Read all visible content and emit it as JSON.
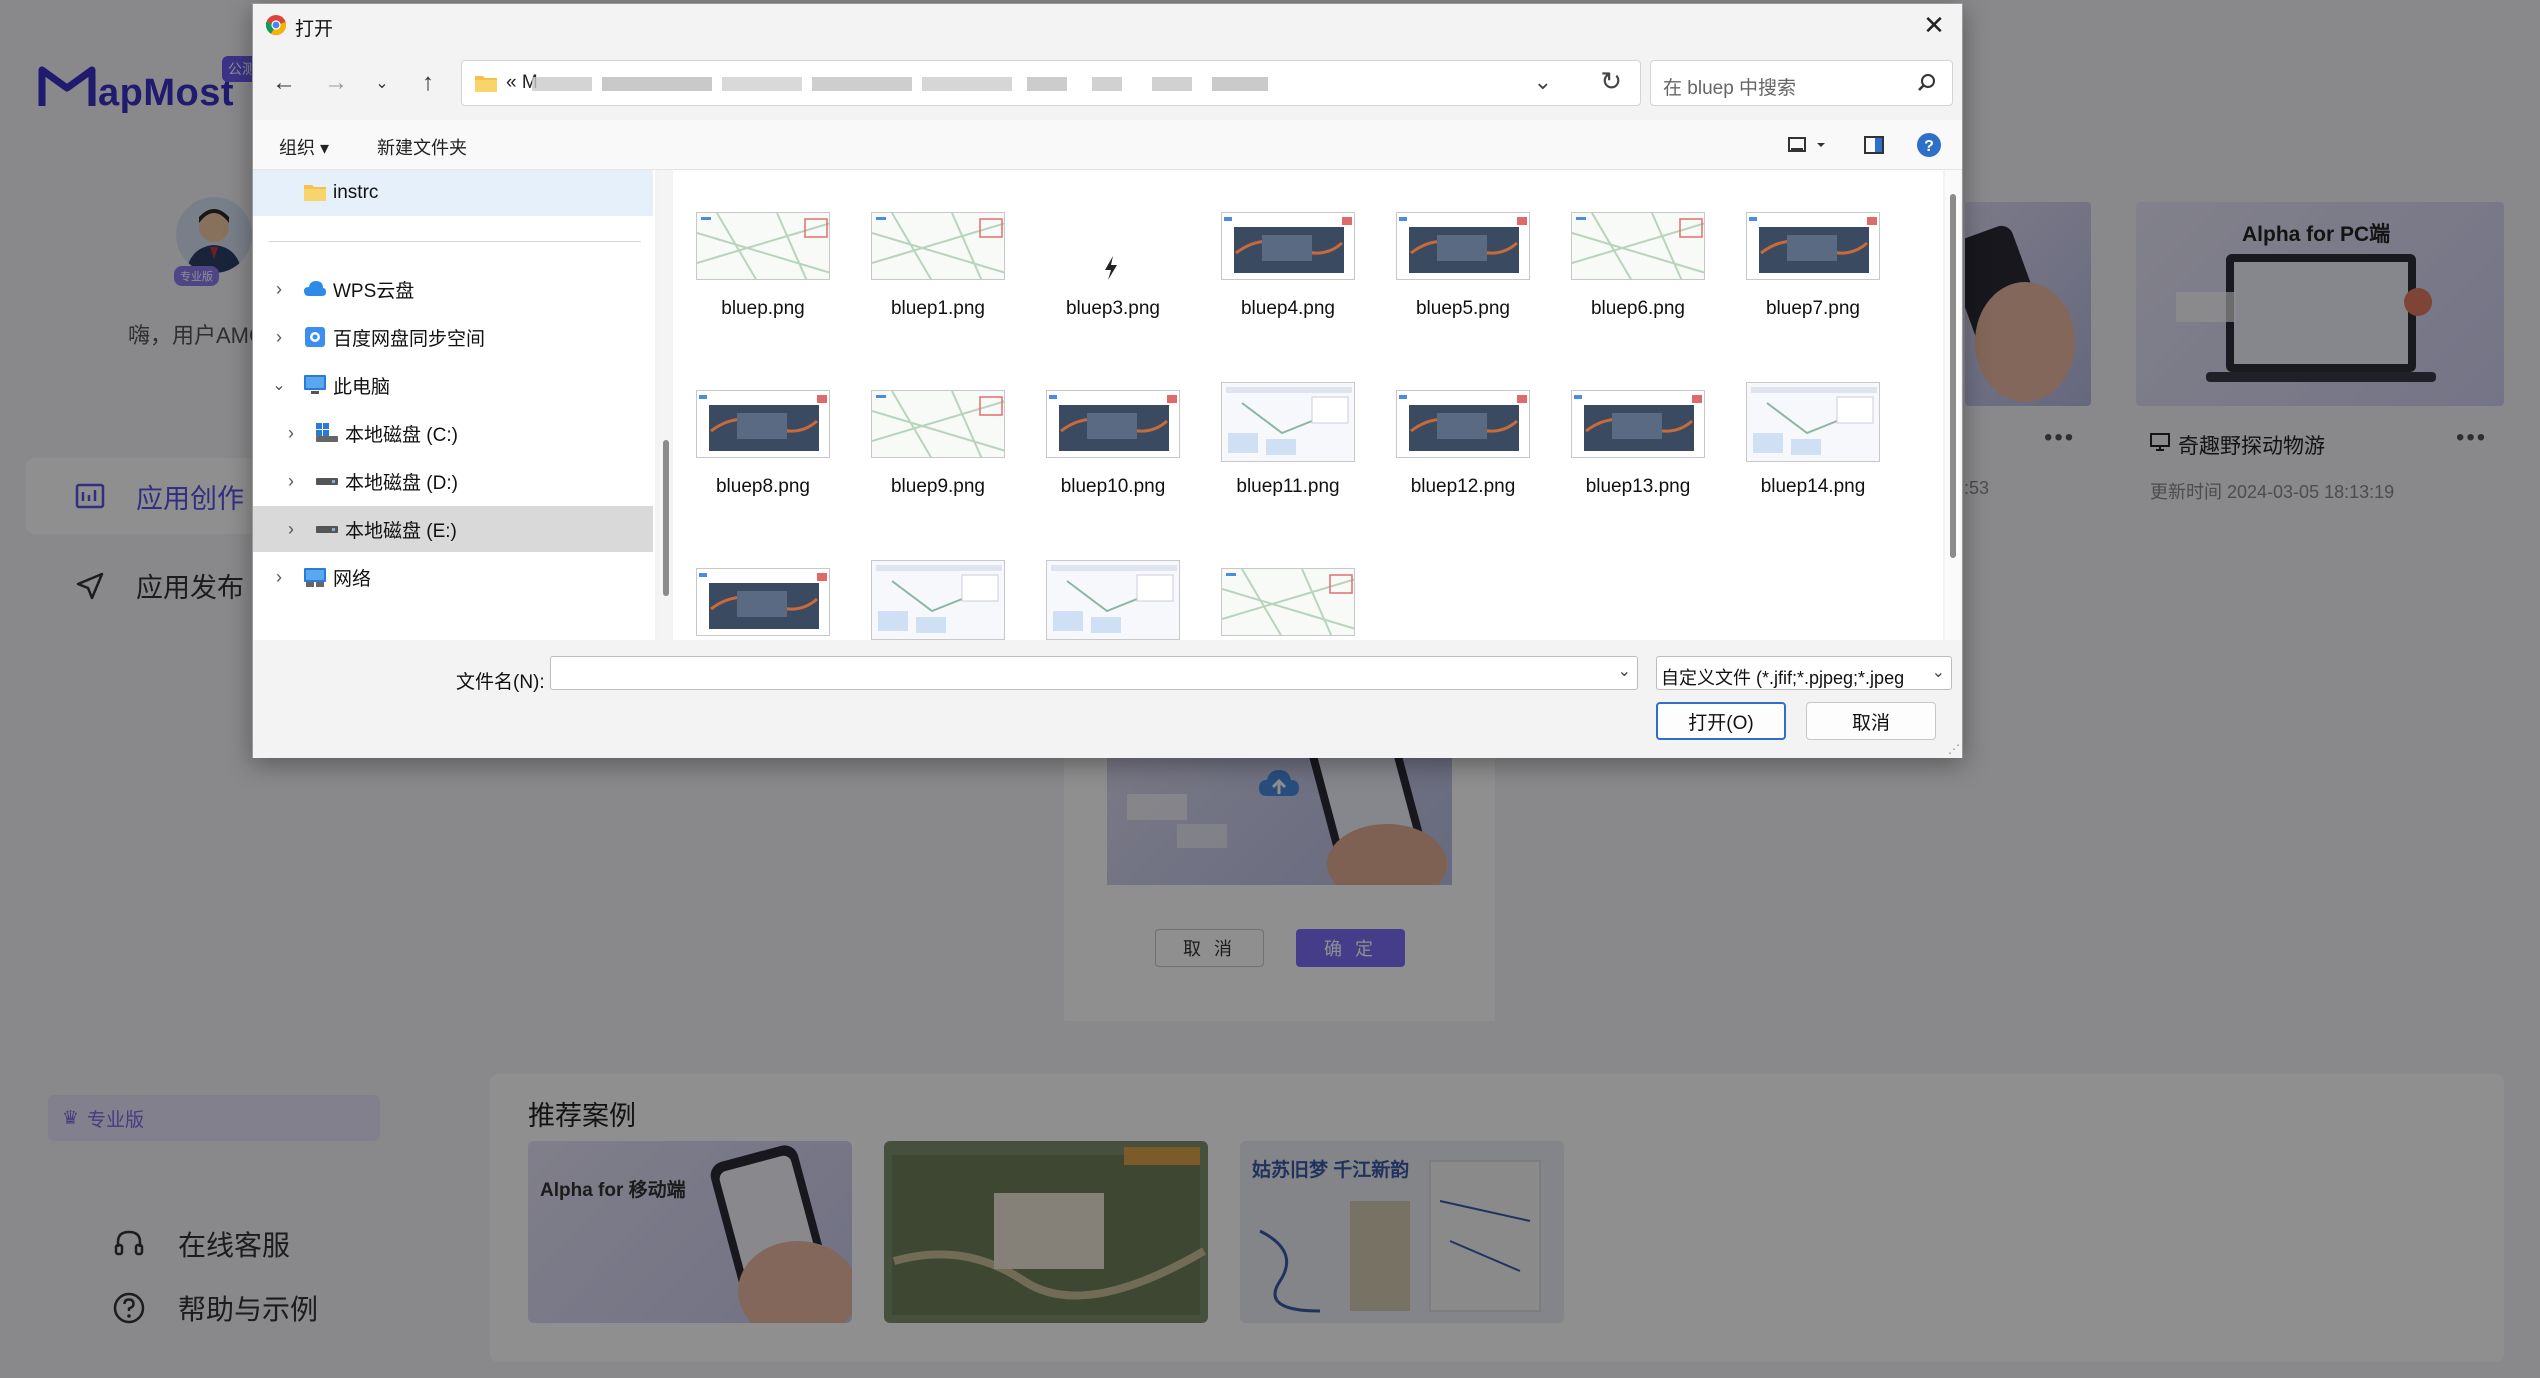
{
  "background_app": {
    "logo_text": "apMost",
    "logo_badge": "公测",
    "avatar_badge": "专业版",
    "greeting": "嗨，用户AMC",
    "nav": [
      {
        "label": "应用创作",
        "icon": "app-create-icon"
      },
      {
        "label": "应用发布",
        "icon": "send-icon"
      }
    ],
    "pro_label": "专业版",
    "side_links": [
      {
        "label": "在线客服",
        "icon": "headset-icon"
      },
      {
        "label": "帮助与示例",
        "icon": "help-circle-icon"
      }
    ],
    "recommend_title": "推荐案例",
    "recommend_cards": [
      {
        "title": "Alpha for 移动端"
      },
      {
        "title": ""
      },
      {
        "title": "姑苏旧梦 千江新韵"
      }
    ],
    "right_card": {
      "image_title": "Alpha for PC端",
      "name": "奇趣野探动物游",
      "update_time": "更新时间 2024-03-05 18:13:19",
      "partial_time": ":53"
    },
    "modal": {
      "cancel_label": "取 消",
      "ok_label": "确 定"
    },
    "colors": {
      "brand": "#5a52e8",
      "modal_ok": "#7b6cf6"
    }
  },
  "dialog": {
    "title": "打开",
    "address_prefix": "« M",
    "search_placeholder": "在 bluep 中搜索",
    "commands": {
      "organize": "组织 ▾",
      "new_folder": "新建文件夹"
    },
    "tree": [
      {
        "label": "instrc",
        "icon": "folder-icon",
        "selected": true
      },
      {
        "label": "WPS云盘",
        "icon": "cloud-icon"
      },
      {
        "label": "百度网盘同步空间",
        "icon": "baidu-drive-icon"
      },
      {
        "label": "此电脑",
        "icon": "computer-icon",
        "expanded": true
      },
      {
        "label": "本地磁盘 (C:)",
        "icon": "drive-c-icon"
      },
      {
        "label": "本地磁盘 (D:)",
        "icon": "drive-icon"
      },
      {
        "label": "本地磁盘 (E:)",
        "icon": "drive-icon",
        "highlighted": true
      },
      {
        "label": "网络",
        "icon": "network-icon"
      }
    ],
    "files": [
      {
        "name": "bluep.png",
        "kind": "map"
      },
      {
        "name": "bluep1.png",
        "kind": "map"
      },
      {
        "name": "bluep3.png",
        "kind": "icon"
      },
      {
        "name": "bluep4.png",
        "kind": "dark"
      },
      {
        "name": "bluep5.png",
        "kind": "dark"
      },
      {
        "name": "bluep6.png",
        "kind": "map"
      },
      {
        "name": "bluep7.png",
        "kind": "dark"
      },
      {
        "name": "bluep8.png",
        "kind": "dark"
      },
      {
        "name": "bluep9.png",
        "kind": "map"
      },
      {
        "name": "bluep10.png",
        "kind": "dark"
      },
      {
        "name": "bluep11.png",
        "kind": "ui"
      },
      {
        "name": "bluep12.png",
        "kind": "dark"
      },
      {
        "name": "bluep13.png",
        "kind": "dark"
      },
      {
        "name": "bluep14.png",
        "kind": "ui"
      },
      {
        "name": "",
        "kind": "dark"
      },
      {
        "name": "",
        "kind": "ui"
      },
      {
        "name": "",
        "kind": "ui"
      },
      {
        "name": "",
        "kind": "map"
      }
    ],
    "filename_label": "文件名(N):",
    "filename_value": "",
    "filetype_value": "自定义文件 (*.jfif;*.pjpeg;*.jpeg",
    "open_button": "打开(O)",
    "cancel_button": "取消"
  }
}
